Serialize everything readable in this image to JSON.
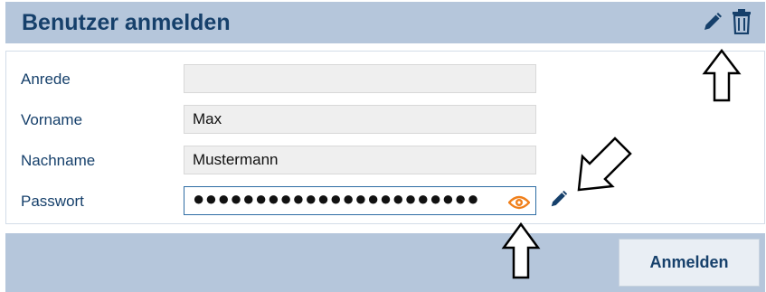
{
  "header": {
    "title": "Benutzer anmelden",
    "edit_icon": "pencil-icon",
    "delete_icon": "trash-icon"
  },
  "form": {
    "salutation": {
      "label": "Anrede",
      "value": ""
    },
    "first_name": {
      "label": "Vorname",
      "value": "Max"
    },
    "last_name": {
      "label": "Nachname",
      "value": "Mustermann"
    },
    "password": {
      "label": "Passwort",
      "value": "●●●●●●●●●●●●●●●●●●●●●●●",
      "reveal_icon": "eye-icon",
      "edit_icon": "pencil-icon"
    }
  },
  "footer": {
    "submit_label": "Anmelden"
  },
  "annotations": [
    "up-arrow",
    "down-left-arrow",
    "up-arrow"
  ],
  "colors": {
    "header_bg": "#b5c6db",
    "title_text": "#16406b",
    "eye_icon": "#f07f1a",
    "active_border": "#2e6da4"
  }
}
